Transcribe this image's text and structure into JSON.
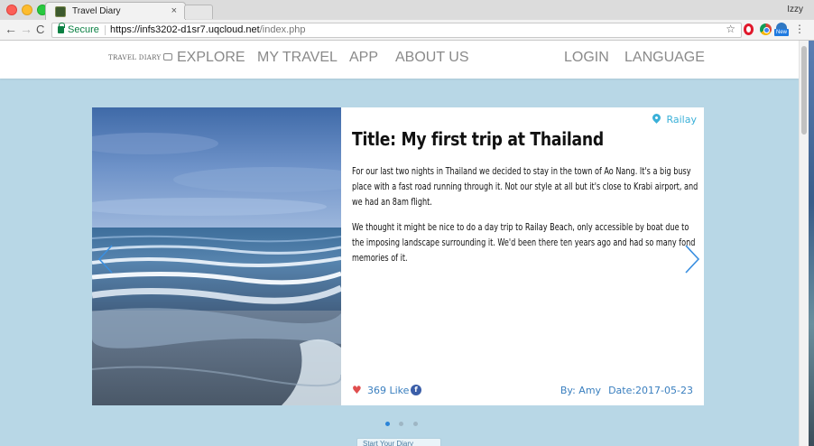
{
  "browser": {
    "tab": {
      "title": "Travel Diary",
      "close": "×",
      "favicon": "travel-diary-favicon"
    },
    "profile": "Izzy",
    "address": {
      "secure_label": "Secure",
      "url_host": "https://infs3202-d1sr7.uqcloud.net",
      "url_path": "/index.php"
    },
    "icons": {
      "back": "←",
      "forward": "→",
      "reload": "C",
      "star": "☆",
      "menu": "⋮",
      "new_badge": "New"
    }
  },
  "site_nav": {
    "logo": "TRAVEL DIARY",
    "links": [
      "EXPLORE",
      "MY TRAVEL",
      "APP",
      "ABOUT US"
    ],
    "right": [
      "LOGIN",
      "LANGUAGE"
    ]
  },
  "slide": {
    "location": "Railay",
    "title": "Title: My first trip at Thailand",
    "paragraphs": [
      "For our last two nights in Thailand we decided to stay in the town of Ao Nang. It's a big busy place with a fast road running through it. Not our style at all but it's close to Krabi airport, and we had an 8am flight.",
      "We thought it might be nice to do a day trip to Railay Beach, only accessible by boat due to the imposing landscape surrounding it. We'd been there ten years ago and had so many fond memories of it."
    ],
    "likes": "369 Like",
    "heart": "♥",
    "fb": "f",
    "author": "By: Amy",
    "date": "Date:2017-05-23",
    "image": "sea-waves-photo"
  },
  "carousel": {
    "dot_count": 3,
    "active_index": 0
  },
  "start_button": "Start Your Diary"
}
